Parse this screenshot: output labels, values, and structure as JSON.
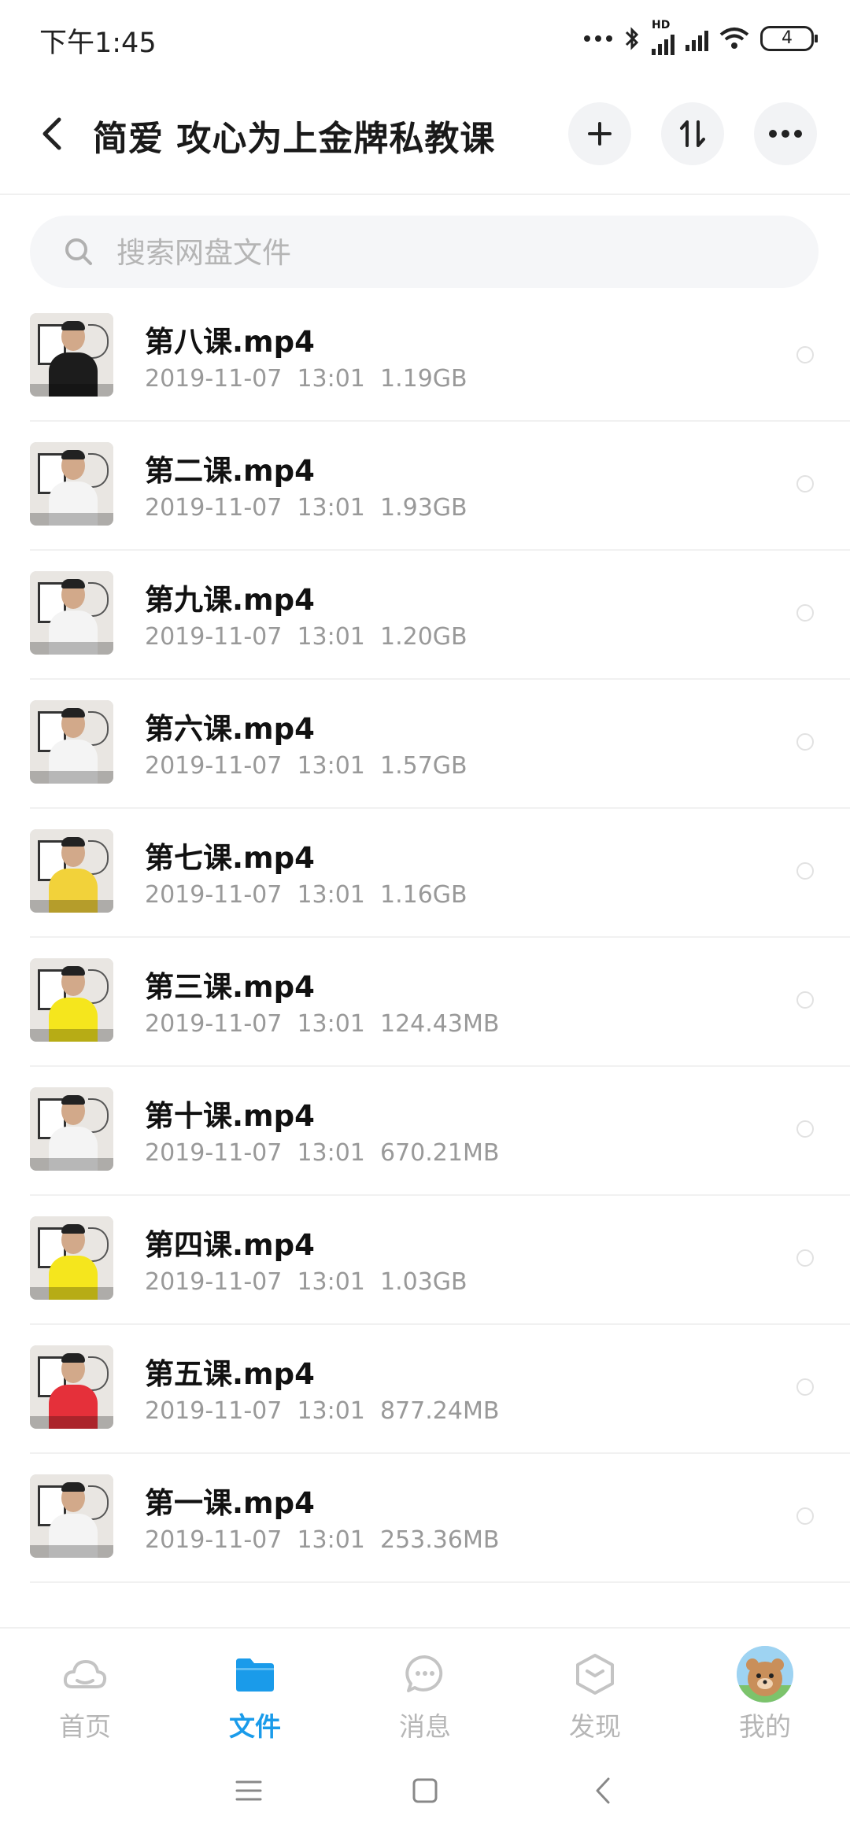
{
  "status_bar": {
    "time": "下午1:45",
    "hd": "HD",
    "battery": "4"
  },
  "header": {
    "title": "简爱 攻心为上金牌私教课"
  },
  "search": {
    "placeholder": "搜索网盘文件"
  },
  "files": [
    {
      "name": "第八课.mp4",
      "date": "2019-11-07",
      "time": "13:01",
      "size": "1.19GB",
      "shirt": "#1c1c1c"
    },
    {
      "name": "第二课.mp4",
      "date": "2019-11-07",
      "time": "13:01",
      "size": "1.93GB",
      "shirt": "#f4f4f4"
    },
    {
      "name": "第九课.mp4",
      "date": "2019-11-07",
      "time": "13:01",
      "size": "1.20GB",
      "shirt": "#f4f4f4"
    },
    {
      "name": "第六课.mp4",
      "date": "2019-11-07",
      "time": "13:01",
      "size": "1.57GB",
      "shirt": "#f4f4f4"
    },
    {
      "name": "第七课.mp4",
      "date": "2019-11-07",
      "time": "13:01",
      "size": "1.16GB",
      "shirt": "#f2d23a"
    },
    {
      "name": "第三课.mp4",
      "date": "2019-11-07",
      "time": "13:01",
      "size": "124.43MB",
      "shirt": "#f5e61d"
    },
    {
      "name": "第十课.mp4",
      "date": "2019-11-07",
      "time": "13:01",
      "size": "670.21MB",
      "shirt": "#f4f4f4"
    },
    {
      "name": "第四课.mp4",
      "date": "2019-11-07",
      "time": "13:01",
      "size": "1.03GB",
      "shirt": "#f5e61d"
    },
    {
      "name": "第五课.mp4",
      "date": "2019-11-07",
      "time": "13:01",
      "size": "877.24MB",
      "shirt": "#e5303a"
    },
    {
      "name": "第一课.mp4",
      "date": "2019-11-07",
      "time": "13:01",
      "size": "253.36MB",
      "shirt": "#f4f4f4"
    }
  ],
  "bottom_nav": [
    {
      "label": "首页",
      "icon": "cloud-icon",
      "active": false
    },
    {
      "label": "文件",
      "icon": "folder-icon",
      "active": true
    },
    {
      "label": "消息",
      "icon": "message-icon",
      "active": false
    },
    {
      "label": "发现",
      "icon": "discover-icon",
      "active": false
    },
    {
      "label": "我的",
      "icon": "avatar",
      "active": false
    }
  ],
  "colors": {
    "accent": "#1a9bea",
    "meta_text": "#999999",
    "nav_inactive": "#b6b6b6"
  }
}
